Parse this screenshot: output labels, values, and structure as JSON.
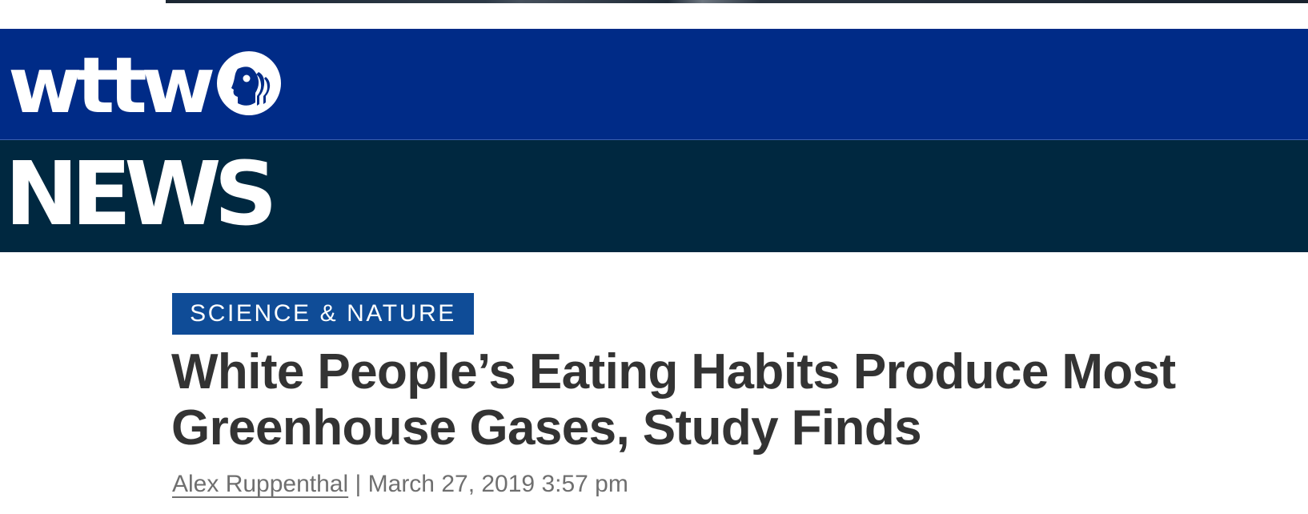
{
  "header": {
    "brand_name": "wttw",
    "logo_icon": "pbs-heads-icon",
    "section_wordmark": "NEWS",
    "brand_color": "#002b87",
    "news_bar_color": "#002840"
  },
  "article": {
    "category": "SCIENCE & NATURE",
    "category_color": "#0f4c97",
    "title_line_1": "White People’s Eating Habits Produce Most",
    "title_line_2": "Greenhouse Gases, Study Finds",
    "author": "Alex Ruppenthal",
    "separator": "|",
    "date": "March 27, 2019 3:57 pm"
  }
}
